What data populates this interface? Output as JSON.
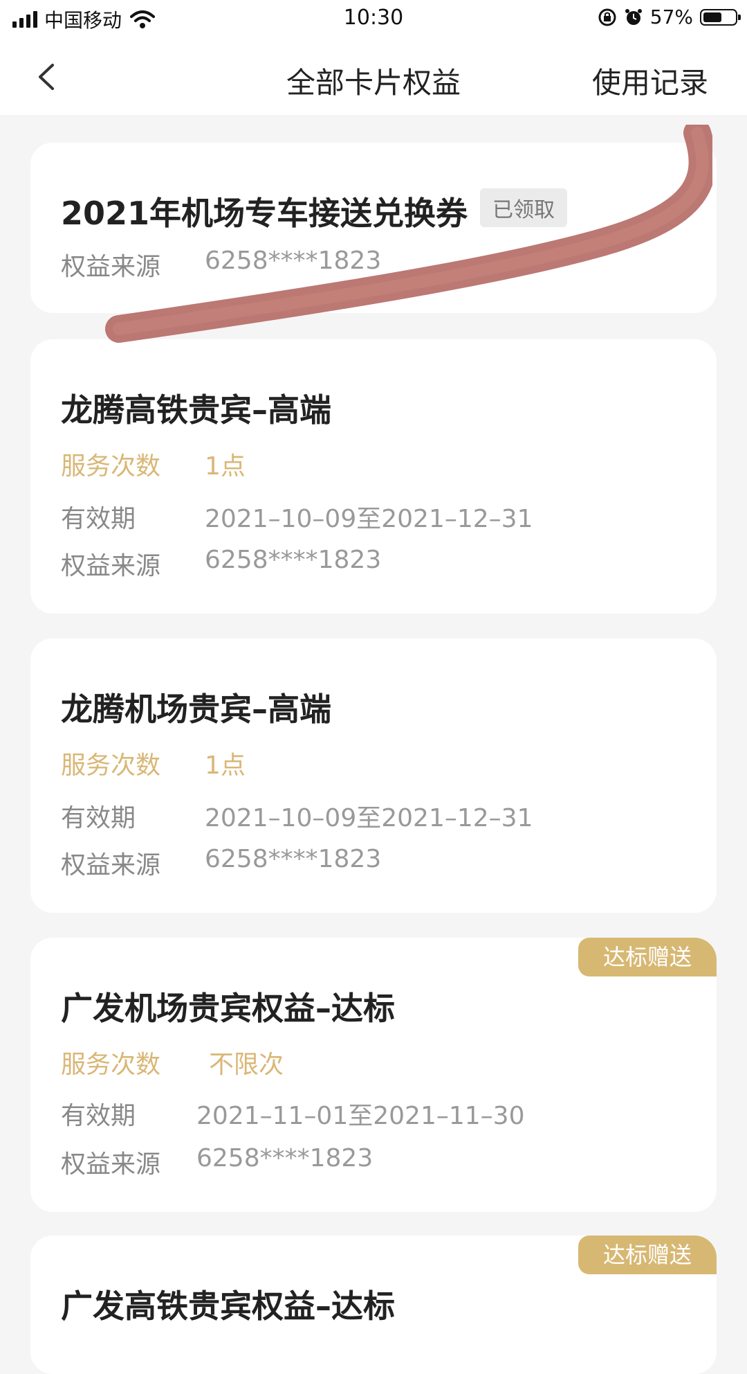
{
  "status_bar": {
    "carrier": "中国移动",
    "time": "10:30",
    "battery_percent": "57%"
  },
  "nav": {
    "title": "全部卡片权益",
    "action": "使用记录"
  },
  "labels": {
    "service_count": "服务次数",
    "validity": "有效期",
    "source": "权益来源"
  },
  "cards": [
    {
      "title": "2021年机场专车接送兑换券",
      "status": "已领取",
      "source": "6258****1823"
    },
    {
      "title": "龙腾高铁贵宾–高端",
      "service_count": "1点",
      "validity": "2021–10–09至2021–12–31",
      "source": "6258****1823"
    },
    {
      "title": "龙腾机场贵宾–高端",
      "service_count": "1点",
      "validity": "2021–10–09至2021–12–31",
      "source": "6258****1823"
    },
    {
      "title": "广发机场贵宾权益–达标",
      "tag": "达标赠送",
      "service_count": "不限次",
      "validity": "2021–11–01至2021–11–30",
      "source": "6258****1823"
    },
    {
      "title": "广发高铁贵宾权益–达标",
      "tag": "达标赠送"
    }
  ],
  "colors": {
    "gold": "#d9b776",
    "tag_gold": "#d7b873",
    "scribble": "#b0605a"
  },
  "icons": [
    "signal-icon",
    "wifi-icon",
    "rotation-lock-icon",
    "alarm-icon",
    "battery-icon",
    "back-arrow-icon"
  ]
}
